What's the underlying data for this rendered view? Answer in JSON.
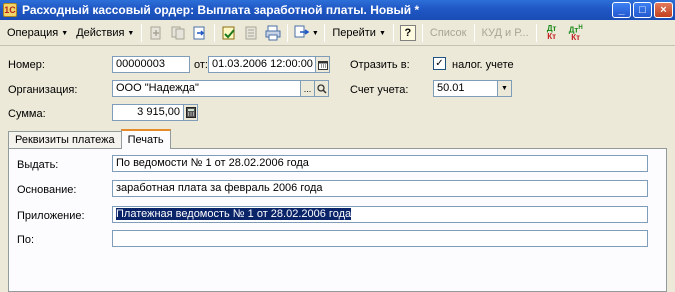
{
  "window": {
    "title": "Расходный кассовый ордер: Выплата заработной платы. Новый *",
    "app_icon_glyph": "1С"
  },
  "toolbar": {
    "operation_label": "Операция",
    "actions_label": "Действия",
    "goto_label": "Перейти",
    "help_label": "?",
    "list_label": "Список",
    "kudir_label": "КУД и Р...",
    "dt_label": "Дт",
    "kt_label": "Кт",
    "dtn_label": "Дт",
    "n_label": "Н",
    "ktn_label": "Кт"
  },
  "form": {
    "number_label": "Номер:",
    "number_value": "00000003",
    "date_label": "от:",
    "date_value": "01.03.2006 12:00:00",
    "reflect_label": "Отразить в:",
    "tax_check_label": "налог. учете",
    "tax_checked": true,
    "org_label": "Организация:",
    "org_value": "ООО \"Надежда\"",
    "account_label": "Счет учета:",
    "account_value": "50.01",
    "sum_label": "Сумма:",
    "sum_value": "3 915,00"
  },
  "tabs": [
    {
      "label": "Реквизиты платежа",
      "active": false
    },
    {
      "label": "Печать",
      "active": true
    }
  ],
  "print_tab": {
    "issue_label": "Выдать:",
    "issue_value": "По ведомости № 1 от 28.02.2006 года",
    "basis_label": "Основание:",
    "basis_value": "заработная плата за февраль 2006 года",
    "appendix_label": "Приложение:",
    "appendix_value": "Платежная ведомость № 1 от 28.02.2006 года",
    "by_label": "По:",
    "by_value": ""
  }
}
